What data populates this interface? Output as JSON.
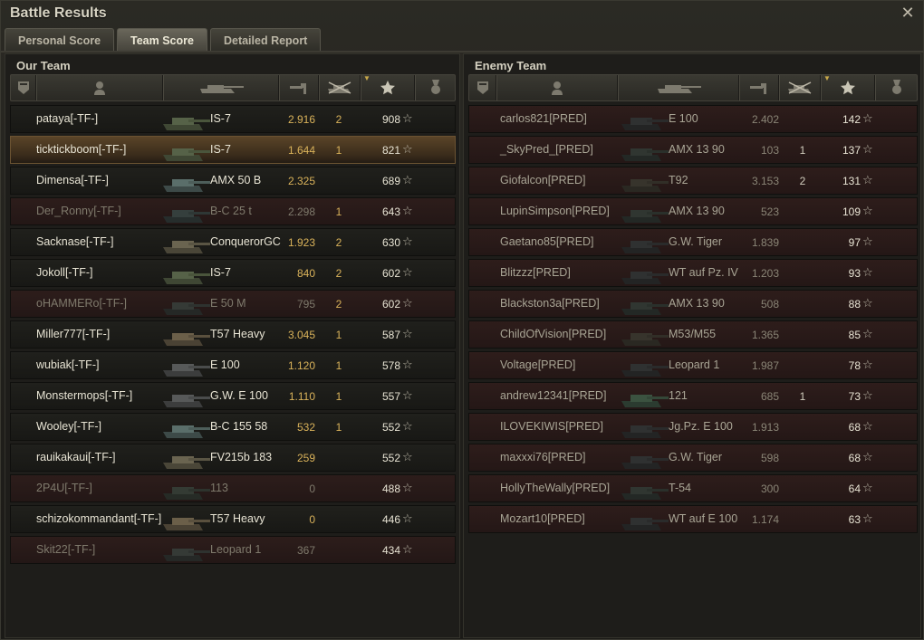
{
  "window": {
    "title": "Battle Results",
    "close_glyph": "✕",
    "tabs": [
      {
        "label": "Personal Score",
        "active": false
      },
      {
        "label": "Team Score",
        "active": true
      },
      {
        "label": "Detailed Report",
        "active": false
      }
    ]
  },
  "icons": {
    "columns": [
      "platoon-icon",
      "player-icon",
      "tank-icon",
      "damage-gun-icon",
      "kills-icon",
      "star-icon",
      "medal-icon"
    ],
    "sort_indicator": "chevron-down-icon"
  },
  "colors": {
    "accent_gold": "#d9b25a",
    "highlight_row": "#5a4428",
    "dead_row": "#2d1d1b"
  },
  "our_team": {
    "title": "Our Team",
    "rows": [
      {
        "name": "pataya[-TF-]",
        "vehicle": "IS-7",
        "xp": "2.916",
        "kills": "2",
        "score": "908",
        "dead": false,
        "highlight": false
      },
      {
        "name": "ticktickboom[-TF-]",
        "vehicle": "IS-7",
        "xp": "1.644",
        "kills": "1",
        "score": "821",
        "dead": false,
        "highlight": true
      },
      {
        "name": "Dimensa[-TF-]",
        "vehicle": "AMX 50 B",
        "xp": "2.325",
        "kills": "",
        "score": "689",
        "dead": false,
        "highlight": false
      },
      {
        "name": "Der_Ronny[-TF-]",
        "vehicle": "B-C 25 t",
        "xp": "2.298",
        "kills": "1",
        "score": "643",
        "dead": true,
        "highlight": false
      },
      {
        "name": "Sacknase[-TF-]",
        "vehicle": "ConquerorGC",
        "xp": "1.923",
        "kills": "2",
        "score": "630",
        "dead": false,
        "highlight": false
      },
      {
        "name": "Jokoll[-TF-]",
        "vehicle": "IS-7",
        "xp": "840",
        "kills": "2",
        "score": "602",
        "dead": false,
        "highlight": false
      },
      {
        "name": "oHAMMERo[-TF-]",
        "vehicle": "E 50 M",
        "xp": "795",
        "kills": "2",
        "score": "602",
        "dead": true,
        "highlight": false
      },
      {
        "name": "Miller777[-TF-]",
        "vehicle": "T57 Heavy",
        "xp": "3.045",
        "kills": "1",
        "score": "587",
        "dead": false,
        "highlight": false
      },
      {
        "name": "wubiak[-TF-]",
        "vehicle": "E 100",
        "xp": "1.120",
        "kills": "1",
        "score": "578",
        "dead": false,
        "highlight": false
      },
      {
        "name": "Monstermops[-TF-]",
        "vehicle": "G.W. E 100",
        "xp": "1.110",
        "kills": "1",
        "score": "557",
        "dead": false,
        "highlight": false
      },
      {
        "name": "Wooley[-TF-]",
        "vehicle": "B-C 155 58",
        "xp": "532",
        "kills": "1",
        "score": "552",
        "dead": false,
        "highlight": false
      },
      {
        "name": "rauikakaui[-TF-]",
        "vehicle": "FV215b 183",
        "xp": "259",
        "kills": "",
        "score": "552",
        "dead": false,
        "highlight": false
      },
      {
        "name": "2P4U[-TF-]",
        "vehicle": "113",
        "xp": "0",
        "kills": "",
        "score": "488",
        "dead": true,
        "highlight": false
      },
      {
        "name": "schizokommandant[-TF-]",
        "vehicle": "T57 Heavy",
        "xp": "0",
        "kills": "",
        "score": "446",
        "dead": false,
        "highlight": false
      },
      {
        "name": "Skit22[-TF-]",
        "vehicle": "Leopard 1",
        "xp": "367",
        "kills": "",
        "score": "434",
        "dead": true,
        "highlight": false
      }
    ]
  },
  "enemy_team": {
    "title": "Enemy Team",
    "rows": [
      {
        "name": "carlos821[PRED]",
        "vehicle": "E 100",
        "xp": "2.402",
        "kills": "",
        "score": "142"
      },
      {
        "name": "_SkyPred_[PRED]",
        "vehicle": "AMX 13 90",
        "xp": "103",
        "kills": "1",
        "score": "137"
      },
      {
        "name": "Giofalcon[PRED]",
        "vehicle": "T92",
        "xp": "3.153",
        "kills": "2",
        "score": "131"
      },
      {
        "name": "LupinSimpson[PRED]",
        "vehicle": "AMX 13 90",
        "xp": "523",
        "kills": "",
        "score": "109"
      },
      {
        "name": "Gaetano85[PRED]",
        "vehicle": "G.W. Tiger",
        "xp": "1.839",
        "kills": "",
        "score": "97"
      },
      {
        "name": "Blitzzz[PRED]",
        "vehicle": "WT auf Pz. IV",
        "xp": "1.203",
        "kills": "",
        "score": "93"
      },
      {
        "name": "Blackston3a[PRED]",
        "vehicle": "AMX 13 90",
        "xp": "508",
        "kills": "",
        "score": "88"
      },
      {
        "name": "ChildOfVision[PRED]",
        "vehicle": "M53/M55",
        "xp": "1.365",
        "kills": "",
        "score": "85"
      },
      {
        "name": "Voltage[PRED]",
        "vehicle": "Leopard 1",
        "xp": "1.987",
        "kills": "",
        "score": "78"
      },
      {
        "name": "andrew12341[PRED]",
        "vehicle": "121",
        "xp": "685",
        "kills": "1",
        "score": "73"
      },
      {
        "name": "ILOVEKIWIS[PRED]",
        "vehicle": "Jg.Pz. E 100",
        "xp": "1.913",
        "kills": "",
        "score": "68"
      },
      {
        "name": "maxxxi76[PRED]",
        "vehicle": "G.W. Tiger",
        "xp": "598",
        "kills": "",
        "score": "68"
      },
      {
        "name": "HollyTheWally[PRED]",
        "vehicle": "T-54",
        "xp": "300",
        "kills": "",
        "score": "64"
      },
      {
        "name": "Mozart10[PRED]",
        "vehicle": "WT auf E 100",
        "xp": "1.174",
        "kills": "",
        "score": "63"
      }
    ]
  }
}
